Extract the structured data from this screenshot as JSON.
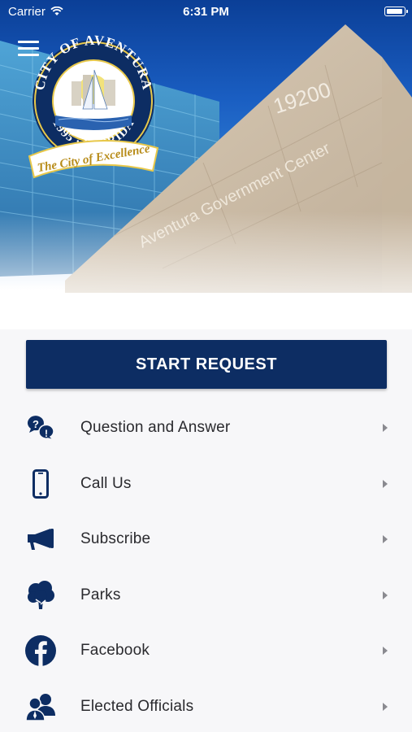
{
  "status_bar": {
    "carrier": "Carrier",
    "time": "6:31 PM"
  },
  "hero": {
    "building_number": "19200",
    "building_sign": "Aventura Government Center",
    "seal": {
      "top_text": "CITY OF AVENTURA",
      "year": "1995",
      "state": "FLORIDA",
      "motto": "The City of Excellence"
    }
  },
  "start_request": {
    "label": "START REQUEST"
  },
  "menu_items": [
    {
      "label": "Question and Answer",
      "icon": "question-answer-icon"
    },
    {
      "label": "Call Us",
      "icon": "phone-icon"
    },
    {
      "label": "Subscribe",
      "icon": "megaphone-icon"
    },
    {
      "label": "Parks",
      "icon": "tree-icon"
    },
    {
      "label": "Facebook",
      "icon": "facebook-icon"
    },
    {
      "label": "Elected Officials",
      "icon": "officials-icon"
    }
  ],
  "colors": {
    "primary": "#0d2d63",
    "sky": "#1a5ec2",
    "background": "#f7f7f9"
  }
}
